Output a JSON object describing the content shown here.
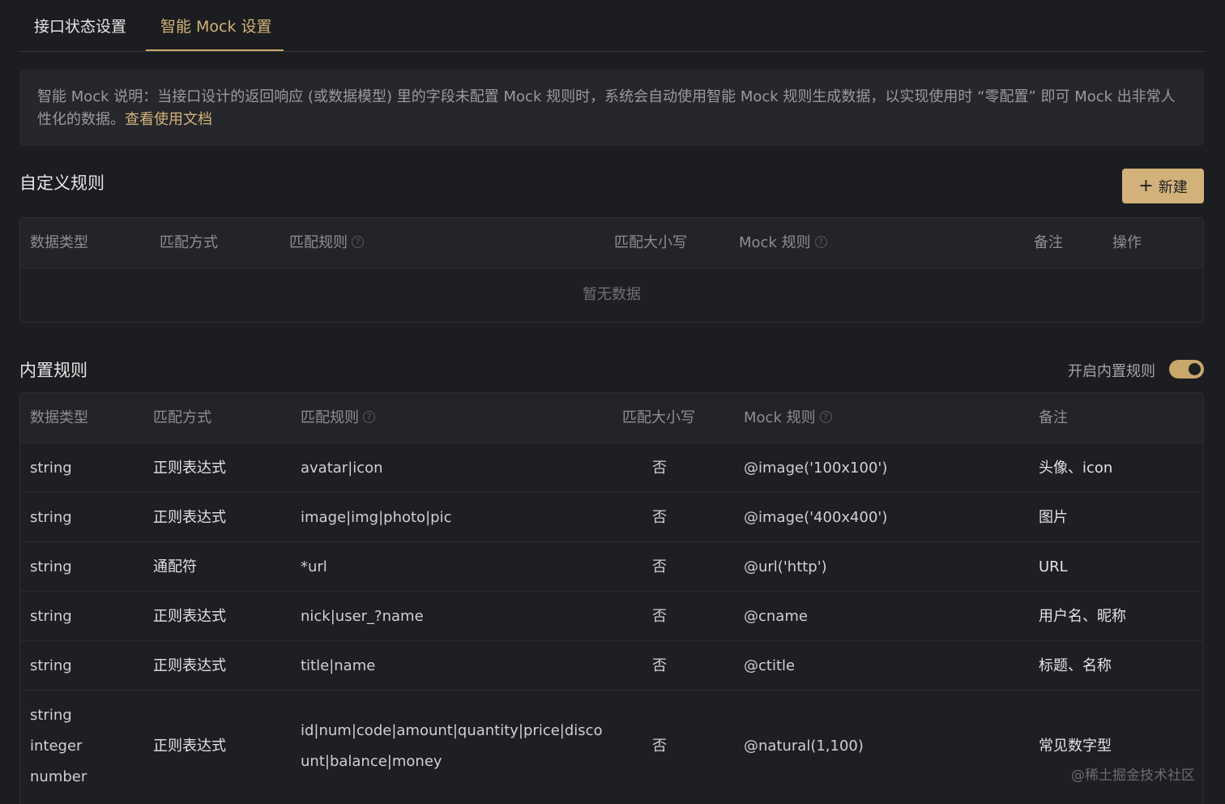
{
  "tabs": [
    {
      "label": "接口状态设置"
    },
    {
      "label": "智能 Mock 设置"
    }
  ],
  "notice": {
    "text": "智能 Mock 说明：当接口设计的返回响应 (或数据模型) 里的字段未配置 Mock 规则时，系统会自动使用智能 Mock 规则生成数据，以实现使用时 “零配置” 即可 Mock 出非常人性化的数据。",
    "link": "查看使用文档"
  },
  "custom": {
    "title": "自定义规则",
    "new_button": "新建",
    "headers": [
      "数据类型",
      "匹配方式",
      "匹配规则",
      "匹配大小写",
      "Mock 规则",
      "备注",
      "操作"
    ],
    "empty": "暂无数据"
  },
  "builtin": {
    "title": "内置规则",
    "toggle_label": "开启内置规则",
    "toggle_on": true,
    "headers": [
      "数据类型",
      "匹配方式",
      "匹配规则",
      "匹配大小写",
      "Mock 规则",
      "备注"
    ],
    "rows": [
      {
        "type": "string",
        "way": "正则表达式",
        "rule": "avatar|icon",
        "case": "否",
        "mock": "@image('100x100')",
        "note": "头像、icon"
      },
      {
        "type": "string",
        "way": "正则表达式",
        "rule": "image|img|photo|pic",
        "case": "否",
        "mock": "@image('400x400')",
        "note": "图片"
      },
      {
        "type": "string",
        "way": "通配符",
        "rule": "*url",
        "case": "否",
        "mock": "@url('http')",
        "note": "URL"
      },
      {
        "type": "string",
        "way": "正则表达式",
        "rule": "nick|user_?name",
        "case": "否",
        "mock": "@cname",
        "note": "用户名、昵称"
      },
      {
        "type": "string",
        "way": "正则表达式",
        "rule": "title|name",
        "case": "否",
        "mock": "@ctitle",
        "note": "标题、名称"
      },
      {
        "type_lines": [
          "string",
          "integer",
          "number"
        ],
        "way": "正则表达式",
        "rule_lines": [
          "id|num|code|amount|quantity|price|disco",
          "unt|balance|money"
        ],
        "case": "否",
        "mock": "@natural(1,100)",
        "note": "常见数字型"
      }
    ]
  },
  "watermark": "@稀土掘金技术社区"
}
